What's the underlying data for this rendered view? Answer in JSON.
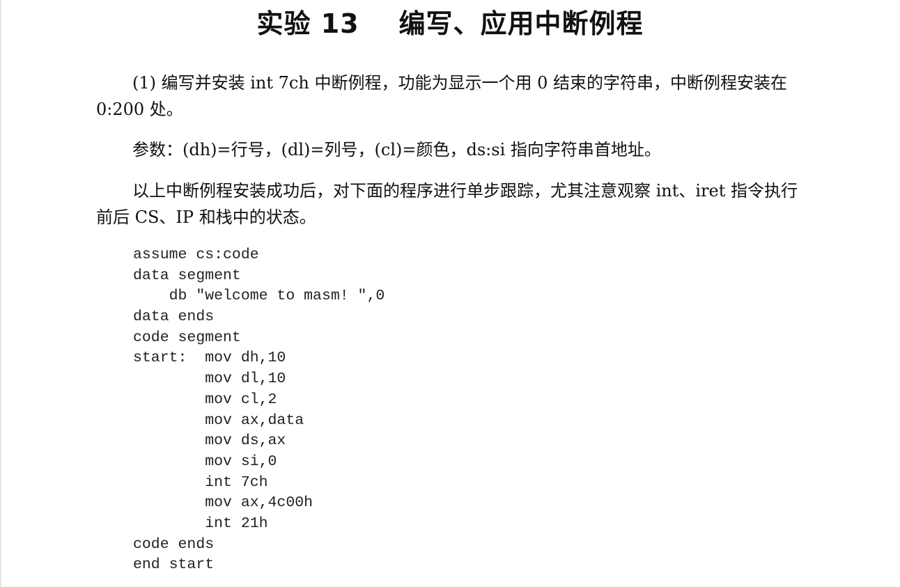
{
  "title": "实验 13    编写、应用中断例程",
  "paragraphs": [
    "(1)  编写并安装 int 7ch 中断例程，功能为显示一个用 0 结束的字符串，中断例程安装在 0:200 处。",
    "参数：(dh)=行号，(dl)=列号，(cl)=颜色，ds:si 指向字符串首地址。",
    "以上中断例程安装成功后，对下面的程序进行单步跟踪，尤其注意观察 int、iret 指令执行前后 CS、IP 和栈中的状态。"
  ],
  "code_lines": [
    "assume cs:code",
    "data segment",
    "    db \"welcome to masm! \",0",
    "data ends",
    "code segment",
    "start:  mov dh,10",
    "        mov dl,10",
    "        mov cl,2",
    "        mov ax,data",
    "        mov ds,ax",
    "        mov si,0",
    "        int 7ch",
    "        mov ax,4c00h",
    "        int 21h",
    "code ends",
    "end start"
  ]
}
